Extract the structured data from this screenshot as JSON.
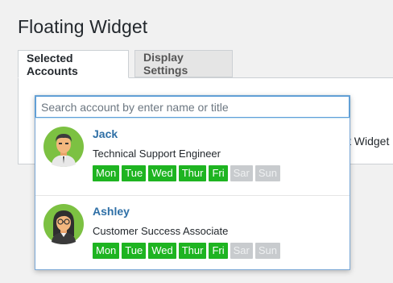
{
  "page": {
    "title": "Floating Widget"
  },
  "tabs": [
    {
      "label": "Selected Accounts",
      "active": true
    },
    {
      "label": "Display Settings",
      "active": false
    }
  ],
  "panel": {
    "partial_text": "t Widget"
  },
  "search": {
    "placeholder": "Search account by enter name or title",
    "value": ""
  },
  "accounts": [
    {
      "name": "Jack",
      "title": "Technical Support Engineer",
      "avatar": "male-avatar",
      "days": [
        {
          "label": "Mon",
          "available": true
        },
        {
          "label": "Tue",
          "available": true
        },
        {
          "label": "Wed",
          "available": true
        },
        {
          "label": "Thur",
          "available": true
        },
        {
          "label": "Fri",
          "available": true
        },
        {
          "label": "Sar",
          "available": false
        },
        {
          "label": "Sun",
          "available": false
        }
      ]
    },
    {
      "name": "Ashley",
      "title": "Customer Success Associate",
      "avatar": "female-avatar",
      "days": [
        {
          "label": "Mon",
          "available": true
        },
        {
          "label": "Tue",
          "available": true
        },
        {
          "label": "Wed",
          "available": true
        },
        {
          "label": "Thur",
          "available": true
        },
        {
          "label": "Fri",
          "available": true
        },
        {
          "label": "Sar",
          "available": false
        },
        {
          "label": "Sun",
          "available": false
        }
      ]
    }
  ],
  "colors": {
    "available": "#1eb421",
    "unavailable": "#c8cbce",
    "name": "#2e6fa6",
    "focus": "#5b9dd9"
  }
}
